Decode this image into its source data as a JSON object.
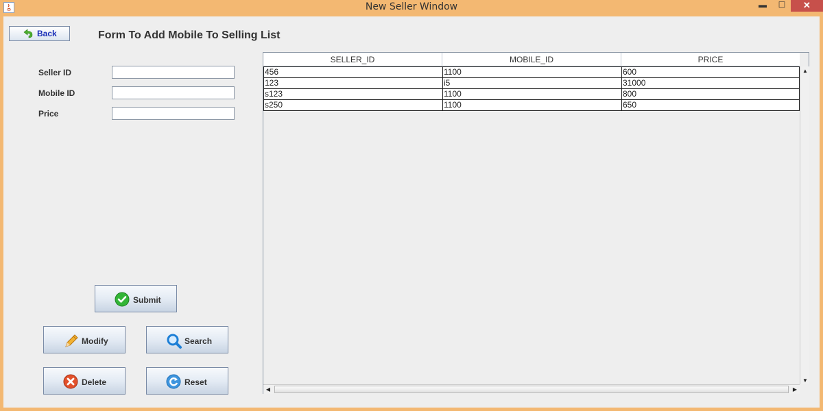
{
  "window": {
    "title": "New Seller Window",
    "min_label": "▬",
    "max_label": "☐",
    "close_label": "✕"
  },
  "back": {
    "label": "Back"
  },
  "form": {
    "title": "Form To Add Mobile To Selling List",
    "fields": [
      {
        "label": "Seller ID",
        "value": ""
      },
      {
        "label": "Mobile ID",
        "value": ""
      },
      {
        "label": "Price",
        "value": ""
      }
    ]
  },
  "buttons": {
    "submit": "Submit",
    "modify": "Modify",
    "search": "Search",
    "delete": "Delete",
    "reset": "Reset"
  },
  "table": {
    "columns": [
      "SELLER_ID",
      "MOBILE_ID",
      "PRICE"
    ],
    "rows": [
      [
        "456",
        "1100",
        "600"
      ],
      [
        "123",
        "i5",
        "31000"
      ],
      [
        "s123",
        "1100",
        "800"
      ],
      [
        "s250",
        "1100",
        "650"
      ]
    ]
  },
  "colors": {
    "titlebar": "#f3b872",
    "close": "#c7504b",
    "link": "#1a2fb8"
  }
}
